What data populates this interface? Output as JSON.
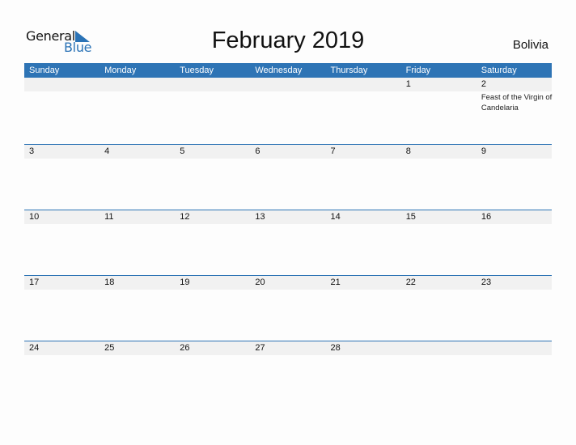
{
  "logo": {
    "line1": "General",
    "line2": "Blue"
  },
  "title": "February 2019",
  "country": "Bolivia",
  "days": [
    "Sunday",
    "Monday",
    "Tuesday",
    "Wednesday",
    "Thursday",
    "Friday",
    "Saturday"
  ],
  "weeks": [
    [
      "",
      "",
      "",
      "",
      "",
      "1",
      "2"
    ],
    [
      "3",
      "4",
      "5",
      "6",
      "7",
      "8",
      "9"
    ],
    [
      "10",
      "11",
      "12",
      "13",
      "14",
      "15",
      "16"
    ],
    [
      "17",
      "18",
      "19",
      "20",
      "21",
      "22",
      "23"
    ],
    [
      "24",
      "25",
      "26",
      "27",
      "28",
      "",
      ""
    ]
  ],
  "events": {
    "0-6": "Feast of the Virgin of Candelaria"
  }
}
